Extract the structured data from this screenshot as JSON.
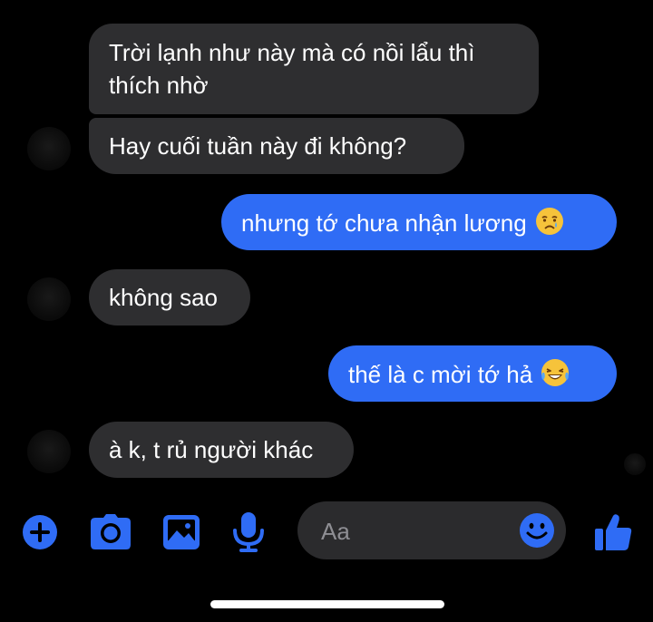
{
  "messages": [
    {
      "from": "them",
      "lines": [
        "Trời lạnh như này mà có nồi lẩu thì",
        "thích nhờ"
      ]
    },
    {
      "from": "them",
      "text": "Hay cuối tuần này đi không?"
    },
    {
      "from": "me",
      "text": "nhưng tớ chưa nhận lương",
      "emoji": "crying-face-emoji"
    },
    {
      "from": "them",
      "text": "không sao"
    },
    {
      "from": "me",
      "text": "thế là c mời tớ hả",
      "emoji": "tears-of-joy-emoji"
    },
    {
      "from": "them",
      "text": "à k, t rủ người khác"
    }
  ],
  "composer": {
    "placeholder": "Aa",
    "icons": [
      "plus-icon",
      "camera-icon",
      "image-icon",
      "microphone-icon",
      "emoji-icon",
      "like-icon"
    ]
  },
  "colors": {
    "accent": "#2f6cf5",
    "incoming_bubble": "#2e2e30",
    "input_bg": "#2b2b2d",
    "background": "#000000"
  }
}
